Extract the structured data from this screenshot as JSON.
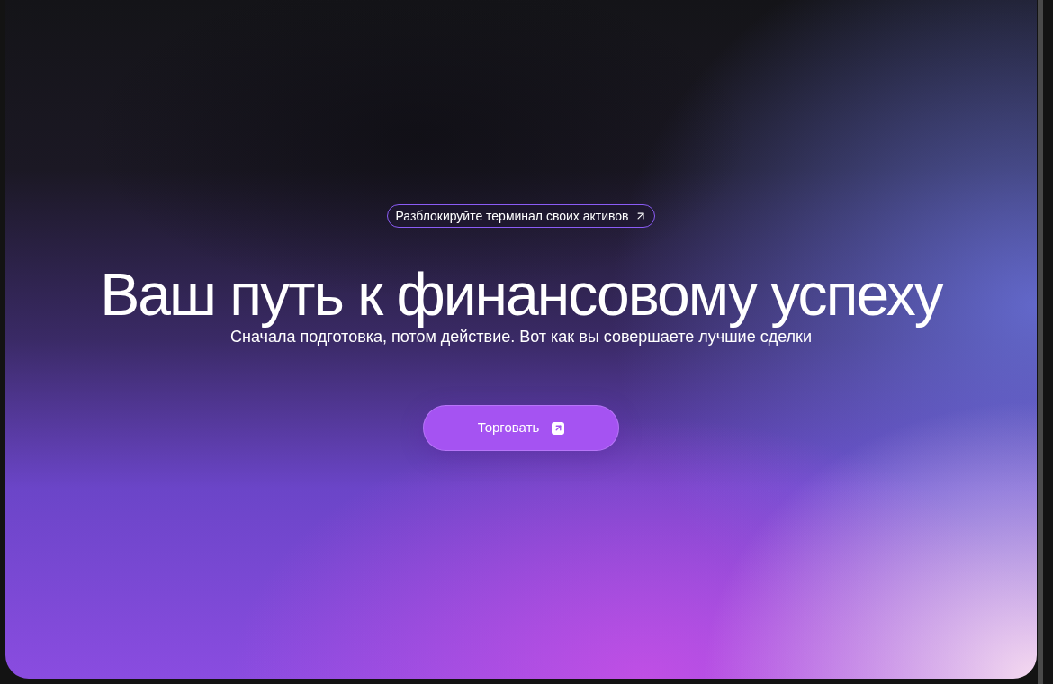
{
  "badge": {
    "label": "Разблокируйте терминал своих активов"
  },
  "hero": {
    "title": "Ваш путь к финансовому успеху",
    "subtitle": "Сначала подготовка, потом действие. Вот как вы совершаете лучшие сделки"
  },
  "cta_button": {
    "label": "Торговать"
  }
}
